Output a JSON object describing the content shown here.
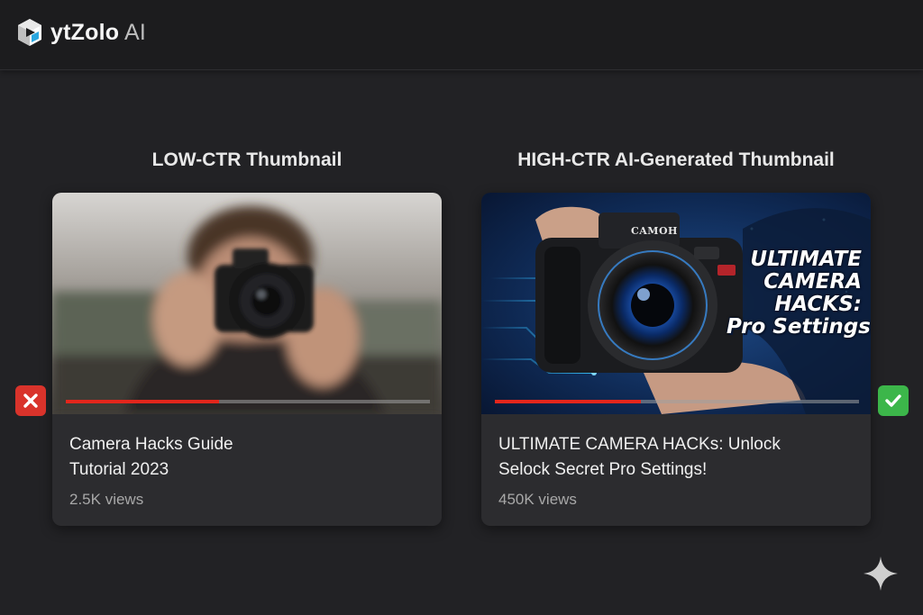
{
  "app": {
    "name": "ytZolo",
    "suffix": "AI"
  },
  "columns": [
    {
      "heading": "LOW-CTR Thumbnail",
      "video_title_lines": [
        "Camera Hacks Guide",
        "Tutorial 2023"
      ],
      "views": "2.5K views",
      "progress": 0.42,
      "verdict": "x-icon"
    },
    {
      "heading": "HIGH-CTR AI-Generated Thumbnail",
      "video_title_lines": [
        "ULTIMATE CAMERA HACKs: Unlock",
        "Selock Secret Pro Settings!"
      ],
      "views": "450K views",
      "progress": 0.4,
      "verdict": "checkmark-icon",
      "thumbnail_overlay": [
        "ULTIMATE",
        "CAMERA",
        "HACKS:",
        "Pro Settings!"
      ],
      "camera_brand": "CAMOH"
    }
  ],
  "colors": {
    "accent_red": "#e3261c",
    "bad": "#d9332b",
    "good": "#3cb64a",
    "background": "#222225"
  }
}
